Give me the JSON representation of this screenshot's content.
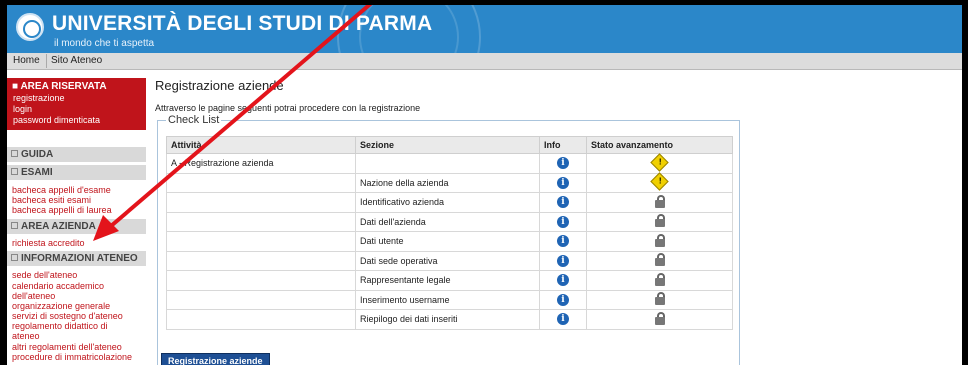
{
  "header": {
    "university_name": "UNIVERSITÀ DEGLI STUDI DI PARMA",
    "motto": "il mondo che ti aspetta"
  },
  "navbar": {
    "items": [
      "Home",
      "Sito Ateneo"
    ]
  },
  "sidebar": {
    "area_riservata": {
      "title": "AREA RISERVATA",
      "links": [
        "registrazione",
        "login",
        "password dimenticata"
      ]
    },
    "guida": "GUIDA",
    "esami": {
      "title": "ESAMI",
      "links": [
        "bacheca appelli d'esame",
        "bacheca esiti esami",
        "bacheca appelli di laurea"
      ]
    },
    "area_azienda": {
      "title": "AREA AZIENDA",
      "links": [
        "richiesta accredito"
      ]
    },
    "informazioni_ateneo": {
      "title": "INFORMAZIONI ATENEO",
      "links": [
        "sede dell'ateneo",
        "calendario accademico dell'ateneo",
        "organizzazione generale",
        "servizi di sostegno d'ateneo",
        "regolamento didattico di ateneo",
        "altri regolamenti dell'ateneo",
        "procedure di immatricolazione"
      ]
    }
  },
  "main": {
    "title": "Registrazione aziende",
    "intro": "Attraverso le pagine seguenti potrai procedere con la registrazione",
    "checklist_legend": "Check List",
    "table": {
      "headers": [
        "Attività",
        "Sezione",
        "Info",
        "Stato avanzamento"
      ],
      "rows": [
        {
          "attivita": "A - Registrazione azienda",
          "sezione": "",
          "status": "warning"
        },
        {
          "attivita": "",
          "sezione": "Nazione della azienda",
          "status": "warning"
        },
        {
          "attivita": "",
          "sezione": "Identificativo azienda",
          "status": "locked"
        },
        {
          "attivita": "",
          "sezione": "Dati dell'azienda",
          "status": "locked"
        },
        {
          "attivita": "",
          "sezione": "Dati utente",
          "status": "locked"
        },
        {
          "attivita": "",
          "sezione": "Dati sede operativa",
          "status": "locked"
        },
        {
          "attivita": "",
          "sezione": "Rappresentante legale",
          "status": "locked"
        },
        {
          "attivita": "",
          "sezione": "Inserimento username",
          "status": "locked"
        },
        {
          "attivita": "",
          "sezione": "Riepilogo dei dati inseriti",
          "status": "locked"
        }
      ]
    },
    "button_label": "Registrazione aziende"
  },
  "icons": {
    "info": "info-icon",
    "warning": "warning-icon",
    "locked": "lock-icon"
  },
  "colors": {
    "header_blue": "#2b87c9",
    "sidebar_red": "#c0141b",
    "button_blue": "#1e4f94",
    "annotation_arrow": "#e3141b"
  }
}
